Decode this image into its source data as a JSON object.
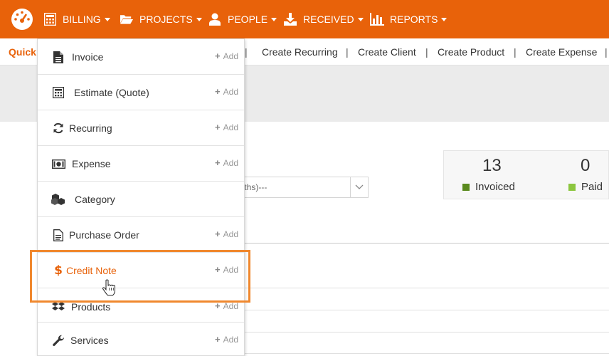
{
  "nav": {
    "items": [
      {
        "label": "BILLING",
        "icon": "calculator-icon"
      },
      {
        "label": "PROJECTS",
        "icon": "folder-open-icon"
      },
      {
        "label": "PEOPLE",
        "icon": "user-icon"
      },
      {
        "label": "RECEIVED",
        "icon": "download-icon"
      },
      {
        "label": "REPORTS",
        "icon": "bar-chart-icon"
      }
    ],
    "logo_icon": "dashboard-gauge-icon"
  },
  "quickbar": {
    "title": "Quick",
    "links": [
      "Create Recurring",
      "Create Client",
      "Create Product",
      "Create Expense"
    ],
    "separator": "|"
  },
  "filter": {
    "select_text": "onths)---"
  },
  "stats": [
    {
      "value": "13",
      "label": "Invoiced",
      "color": "#5a8a1e"
    },
    {
      "value": "0",
      "label": "Paid",
      "color": "#8cc63f"
    }
  ],
  "dropdown": {
    "add_label": "Add",
    "items": [
      {
        "label": "Invoice",
        "icon": "file-text-icon",
        "has_add": true
      },
      {
        "label": "Estimate (Quote)",
        "icon": "calculator-icon",
        "has_add": true
      },
      {
        "label": "Recurring",
        "icon": "refresh-icon",
        "has_add": true
      },
      {
        "label": "Expense",
        "icon": "money-icon",
        "has_add": true
      },
      {
        "label": "Category",
        "icon": "cubes-icon",
        "has_add": false
      },
      {
        "label": "Purchase Order",
        "icon": "file-outline-icon",
        "has_add": true
      },
      {
        "label": "Credit Note",
        "icon": "dollar-icon",
        "has_add": true,
        "active": true
      },
      {
        "label": "Products",
        "icon": "dropbox-icon",
        "has_add": true
      },
      {
        "label": "Services",
        "icon": "wrench-icon",
        "has_add": true
      }
    ]
  },
  "colors": {
    "brand": "#e8620a",
    "highlight": "#f0882e"
  }
}
